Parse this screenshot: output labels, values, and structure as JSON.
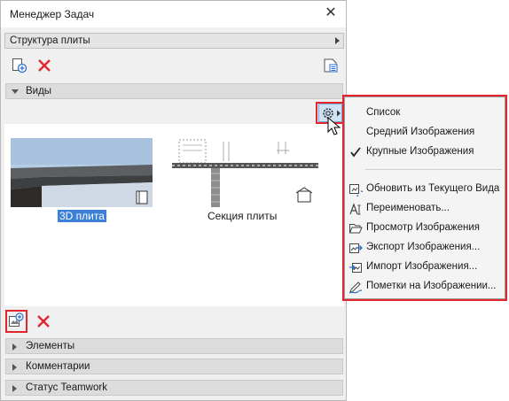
{
  "window": {
    "title": "Менеджер Задач"
  },
  "structure": {
    "label": "Структура плиты"
  },
  "views_section": {
    "label": "Виды"
  },
  "thumbnails": [
    {
      "label": "3D плита",
      "selected": true
    },
    {
      "label": "Секция плиты",
      "selected": false
    }
  ],
  "bottom_sections": [
    {
      "label": "Элементы"
    },
    {
      "label": "Комментарии"
    },
    {
      "label": "Статус Teamwork"
    }
  ],
  "menu": {
    "view_options": [
      "Список",
      "Средний Изображения",
      "Крупные Изображения"
    ],
    "checked_option": "Крупные Изображения",
    "actions": [
      {
        "label": "Обновить из Текущего Вида",
        "icon": "refresh-view-icon"
      },
      {
        "label": "Переименовать...",
        "icon": "rename-icon"
      },
      {
        "label": "Просмотр Изображения",
        "icon": "folder-open-icon"
      },
      {
        "label": "Экспорт Изображения...",
        "icon": "export-image-icon"
      },
      {
        "label": "Импорт Изображения...",
        "icon": "import-image-icon"
      },
      {
        "label": "Пометки на Изображении...",
        "icon": "markup-pen-icon"
      }
    ]
  },
  "colors": {
    "highlight": "#e3262e",
    "selection": "#3b7fd6",
    "accent_blue": "#2a6fc9"
  }
}
